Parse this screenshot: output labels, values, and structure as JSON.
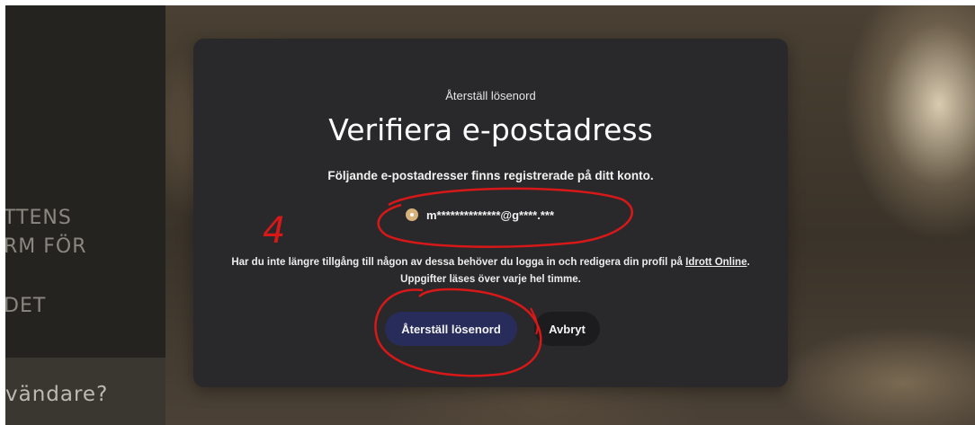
{
  "background": {
    "side_lines": [
      "TTENS",
      "RM FÖR",
      "DET",
      "vändare?"
    ]
  },
  "modal": {
    "subtitle": "Återställ lösenord",
    "title": "Verifiera e-postadress",
    "description": "Följande e-postadresser finns registrerade på ditt konto.",
    "email_option": "m**************@g****.***",
    "info_part1": "Har du inte längre tillgång till någon av dessa behöver du logga in och redigera din profil på",
    "info_link": "Idrott Online",
    "info_part2": ". Uppgifter läses över varje hel timme.",
    "primary_button": "Återställ lösenord",
    "secondary_button": "Avbryt"
  },
  "annotation": {
    "number": "4",
    "color": "#d81818"
  },
  "colors": {
    "modal_bg": "#29292b",
    "primary_button": "#282c5a",
    "radio": "#d7b27a"
  }
}
